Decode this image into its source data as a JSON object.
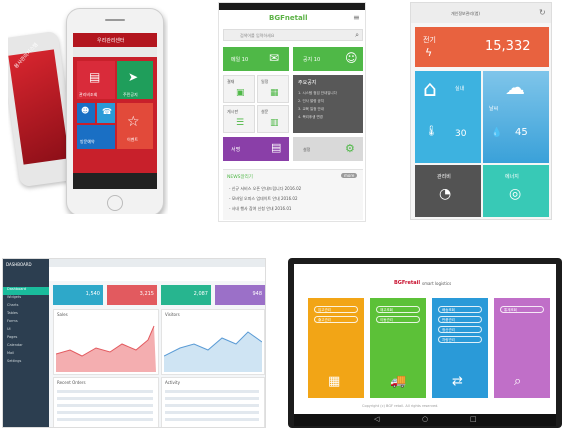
{
  "phones": {
    "back_tile_text": "용사관리시스템",
    "screen_title": "우리관리센터",
    "tiles": [
      {
        "label": "관리비조회",
        "color": "#d92b3a"
      },
      {
        "label": "주민공지",
        "color": "#1f9e5b"
      },
      {
        "label": "커뮤니티",
        "color": "#1a6fc4"
      },
      {
        "label": "민원",
        "color": "#2a9bd8"
      },
      {
        "label": "방문예약",
        "color": "#1a6fc4"
      },
      {
        "label": "이벤트",
        "color": "#e24a3a"
      }
    ]
  },
  "app2": {
    "logo": "BGFnetall",
    "search_placeholder": "검색어를 입력하세요",
    "tile_mail": "메일 10",
    "tile_notice": "공지 10",
    "tile_approval": "결재",
    "tile_schedule": "일정",
    "tile_board": "게시판",
    "tile_survey": "설문",
    "tile_sign": "서명",
    "tile_settings": "설정",
    "panel_title": "주요공지",
    "panel_lines": [
      "1. 시스템 점검 안내입니다",
      "2. 인사 발령 공지",
      "3. 교육 일정 안내",
      "4. 복리후생 변경"
    ],
    "notice_title": "NEWS알리기",
    "more_button": "more",
    "notice_lines": [
      "- 신규 서비스 오픈 안내드립니다 2016.02",
      "- 모바일 오피스 업데이트 안내 2016.02",
      "- 사내 행사 참여 신청 안내 2016.01"
    ]
  },
  "app3": {
    "title": "개인정보관리(앱)",
    "top_label": "전기",
    "top_value": "15,332",
    "home_label": "실내",
    "weather_label": "날씨",
    "temp_value": "30",
    "humid_value": "45",
    "bottom_left_label": "관리비",
    "bottom_right_label": "에너지"
  },
  "dashboard": {
    "brand": "DASHBOARD",
    "sidebar_items": [
      "Dashboard",
      "Widgets",
      "Charts",
      "Tables",
      "Forms",
      "UI",
      "Pages",
      "Calendar",
      "Mail",
      "Settings"
    ],
    "cards": [
      {
        "value": "1,540",
        "color": "#2ea8c9"
      },
      {
        "value": "3,215",
        "color": "#e25a5f"
      },
      {
        "value": "2,087",
        "color": "#27b58f"
      },
      {
        "value": "948",
        "color": "#9b70c8"
      }
    ],
    "chart1_title": "Sales",
    "chart2_title": "Visitors",
    "table_title": "Recent Orders",
    "table2_title": "Activity"
  },
  "tablet": {
    "brand": "BGFretail",
    "brand_suffix": "smart logistics",
    "cards": [
      {
        "color": "#f2a516",
        "items": [
          "입고관리",
          "출고관리"
        ]
      },
      {
        "color": "#5cc138",
        "items": [
          "재고조회",
          "이동관리"
        ]
      },
      {
        "color": "#2a9ad8",
        "items": [
          "배송조회",
          "반품관리",
          "정산관리",
          "차량관리"
        ]
      },
      {
        "color": "#c06fc8",
        "items": [
          "통계조회"
        ]
      }
    ],
    "footer": "Copyright (c) BGF retail. All rights reserved."
  }
}
